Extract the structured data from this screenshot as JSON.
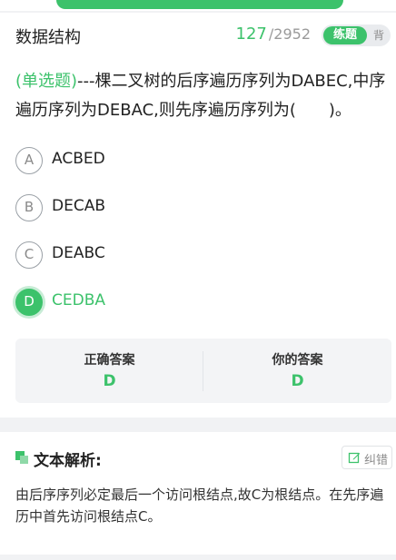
{
  "header": {
    "subject": "数据结构",
    "current": "127",
    "separator": "/",
    "total": "2952",
    "mode_active": "练题",
    "mode_inactive": "背"
  },
  "question": {
    "type_label": "(单选题)",
    "text": "---棵二叉树的后序遍历序列为DABEC,中序遍历序列为DEBAC,则先序遍历序列为(　　)。"
  },
  "options": [
    {
      "letter": "A",
      "text": "ACBED"
    },
    {
      "letter": "B",
      "text": "DECAB"
    },
    {
      "letter": "C",
      "text": "DEABC"
    },
    {
      "letter": "D",
      "text": "CEDBA"
    }
  ],
  "answer": {
    "correct_label": "正确答案",
    "correct_value": "D",
    "yours_label": "你的答案",
    "yours_value": "D"
  },
  "analysis": {
    "title": "文本解析:",
    "correction_label": "纠错",
    "text": "由后序序列必定最后一个访问根结点,故C为根结点。在先序遍历中首先访问根结点C。"
  },
  "colors": {
    "accent": "#3cc26b",
    "page_background": "#f1f2f4"
  }
}
